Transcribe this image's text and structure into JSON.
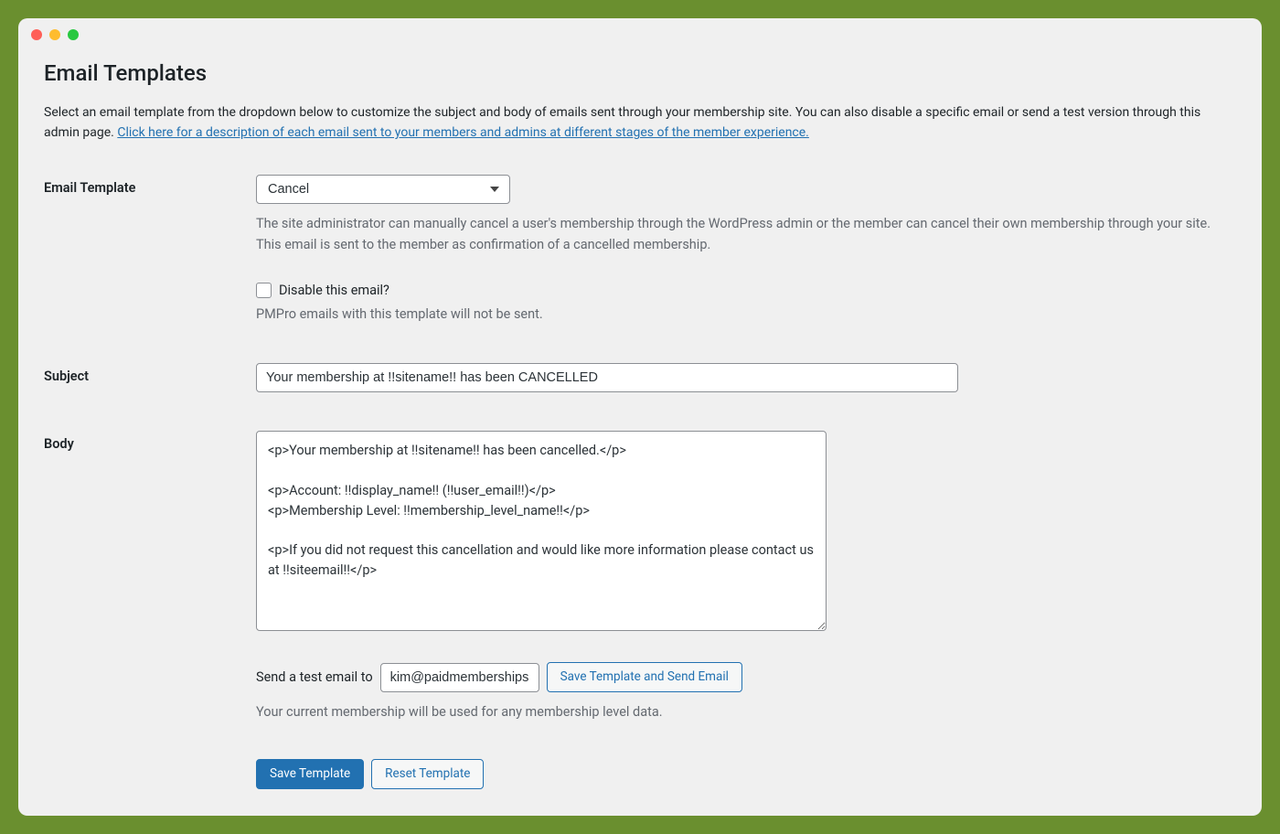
{
  "page": {
    "title": "Email Templates",
    "intro_text": "Select an email template from the dropdown below to customize the subject and body of emails sent through your membership site. You can also disable a specific email or send a test version through this admin page. ",
    "intro_link": "Click here for a description of each email sent to your members and admins at different stages of the member experience."
  },
  "labels": {
    "email_template": "Email Template",
    "subject": "Subject",
    "body": "Body"
  },
  "template_select": {
    "value": "Cancel",
    "helper": "The site administrator can manually cancel a user's membership through the WordPress admin or the member can cancel their own membership through your site. This email is sent to the member as confirmation of a cancelled membership."
  },
  "disable": {
    "label": "Disable this email?",
    "helper": "PMPro emails with this template will not be sent."
  },
  "subject_value": "Your membership at !!sitename!! has been CANCELLED",
  "body_value": "<p>Your membership at !!sitename!! has been cancelled.</p>\n\n<p>Account: !!display_name!! (!!user_email!!)</p>\n<p>Membership Level: !!membership_level_name!!</p>\n\n<p>If you did not request this cancellation and would like more information please contact us at !!siteemail!!</p>",
  "test": {
    "label": "Send a test email to",
    "value": "kim@paidmemberships",
    "button": "Save Template and Send Email",
    "helper": "Your current membership will be used for any membership level data."
  },
  "actions": {
    "save": "Save Template",
    "reset": "Reset Template"
  }
}
